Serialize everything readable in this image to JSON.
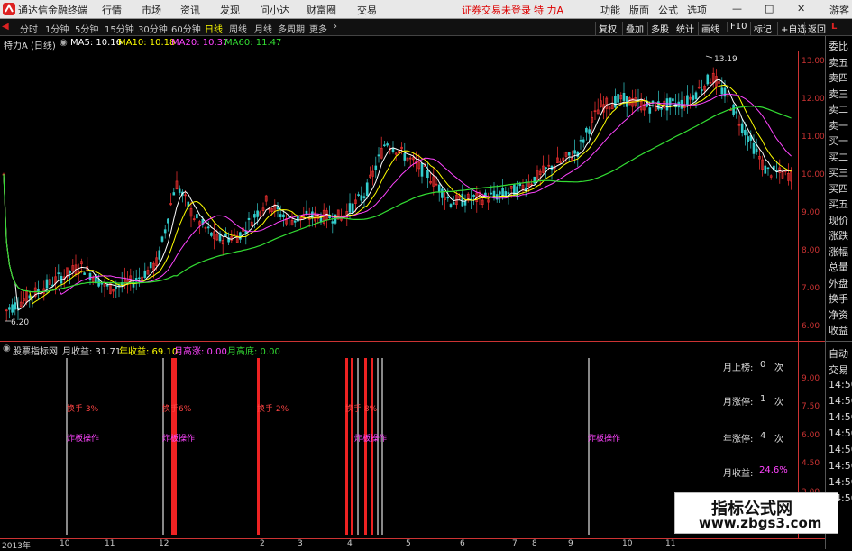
{
  "menubar": {
    "app_title": "通达信金融终端",
    "menus": [
      "行情",
      "市场",
      "资讯",
      "发现",
      "问小达",
      "财富圈",
      "交易"
    ],
    "status_text": "证券交易未登录",
    "stock_name": "特 力A",
    "right_buttons": [
      "功能",
      "版面",
      "公式",
      "选项"
    ],
    "user": "游客"
  },
  "periodbar": {
    "periods": [
      "分时",
      "1分钟",
      "5分钟",
      "15分钟",
      "30分钟",
      "60分钟",
      "日线",
      "周线",
      "月线",
      "多周期",
      "更多"
    ],
    "active_period": "日线",
    "tools": [
      "复权",
      "叠加",
      "多股",
      "统计",
      "画线",
      "F10",
      "标记",
      "+自选",
      "返回"
    ]
  },
  "chart_info": {
    "title": "特力A (日线)",
    "ma5": "MA5: 10.16",
    "ma10": "MA10: 10.18",
    "ma20": "MA20: 10.37",
    "ma60": "MA60: 11.47"
  },
  "price_labels": {
    "high": "13.19",
    "low": "6.20"
  },
  "price_axis": [
    "13.00",
    "12.00",
    "11.00",
    "10.00",
    "9.00",
    "8.00",
    "7.00",
    "6.00"
  ],
  "colors": {
    "ma5": "#ffffff",
    "ma10": "#ffff00",
    "ma20": "#ff44ff",
    "ma60": "#33dd33",
    "up": "#ff3333",
    "down": "#33cccc"
  },
  "indicator": {
    "name": "股票指标网",
    "monthly_return": "月收益: 31.71",
    "annual_return": "年收益: 69.10",
    "month_high": "月高涨: 0.00",
    "month_low": "月高底: 0.00",
    "axis": [
      "9.00",
      "7.50",
      "6.00",
      "4.50",
      "3.00"
    ],
    "stats": [
      {
        "label": "月上榜:",
        "value": "0",
        "unit": "次"
      },
      {
        "label": "月涨停:",
        "value": "1",
        "unit": "次"
      },
      {
        "label": "年涨停:",
        "value": "4",
        "unit": "次"
      },
      {
        "label": "月收益:",
        "value": "24.6%",
        "unit": ""
      }
    ],
    "signals": [
      {
        "top": "换手 3%",
        "bottom": "炸板操作"
      },
      {
        "top": "换手6%",
        "bottom": "炸板操作"
      },
      {
        "top": "换手 2%",
        "bottom": ""
      },
      {
        "top": "换手 8%",
        "bottom": "炸板操作"
      },
      {
        "top": "",
        "bottom": "炸板操作"
      }
    ]
  },
  "right_panel": {
    "top_items": [
      "委比",
      "卖五",
      "卖四",
      "卖三",
      "卖二",
      "卖一",
      "买一",
      "买二",
      "买三",
      "买四",
      "买五",
      "现价",
      "涨跌",
      "涨幅",
      "总量",
      "外盘",
      "换手",
      "净资",
      "收益"
    ],
    "bottom_items": [
      "自动",
      "交易",
      "14:50",
      "14:50",
      "14:50",
      "14:50",
      "14:50",
      "14:50",
      "14:50",
      "14:50"
    ]
  },
  "date_axis": [
    "2013年",
    "10",
    "11",
    "12",
    "2",
    "3",
    "4",
    "5",
    "6",
    "7",
    "8",
    "9",
    "10",
    "11"
  ],
  "watermark": {
    "title": "指标公式网",
    "url": "www.zbgs3.com"
  }
}
